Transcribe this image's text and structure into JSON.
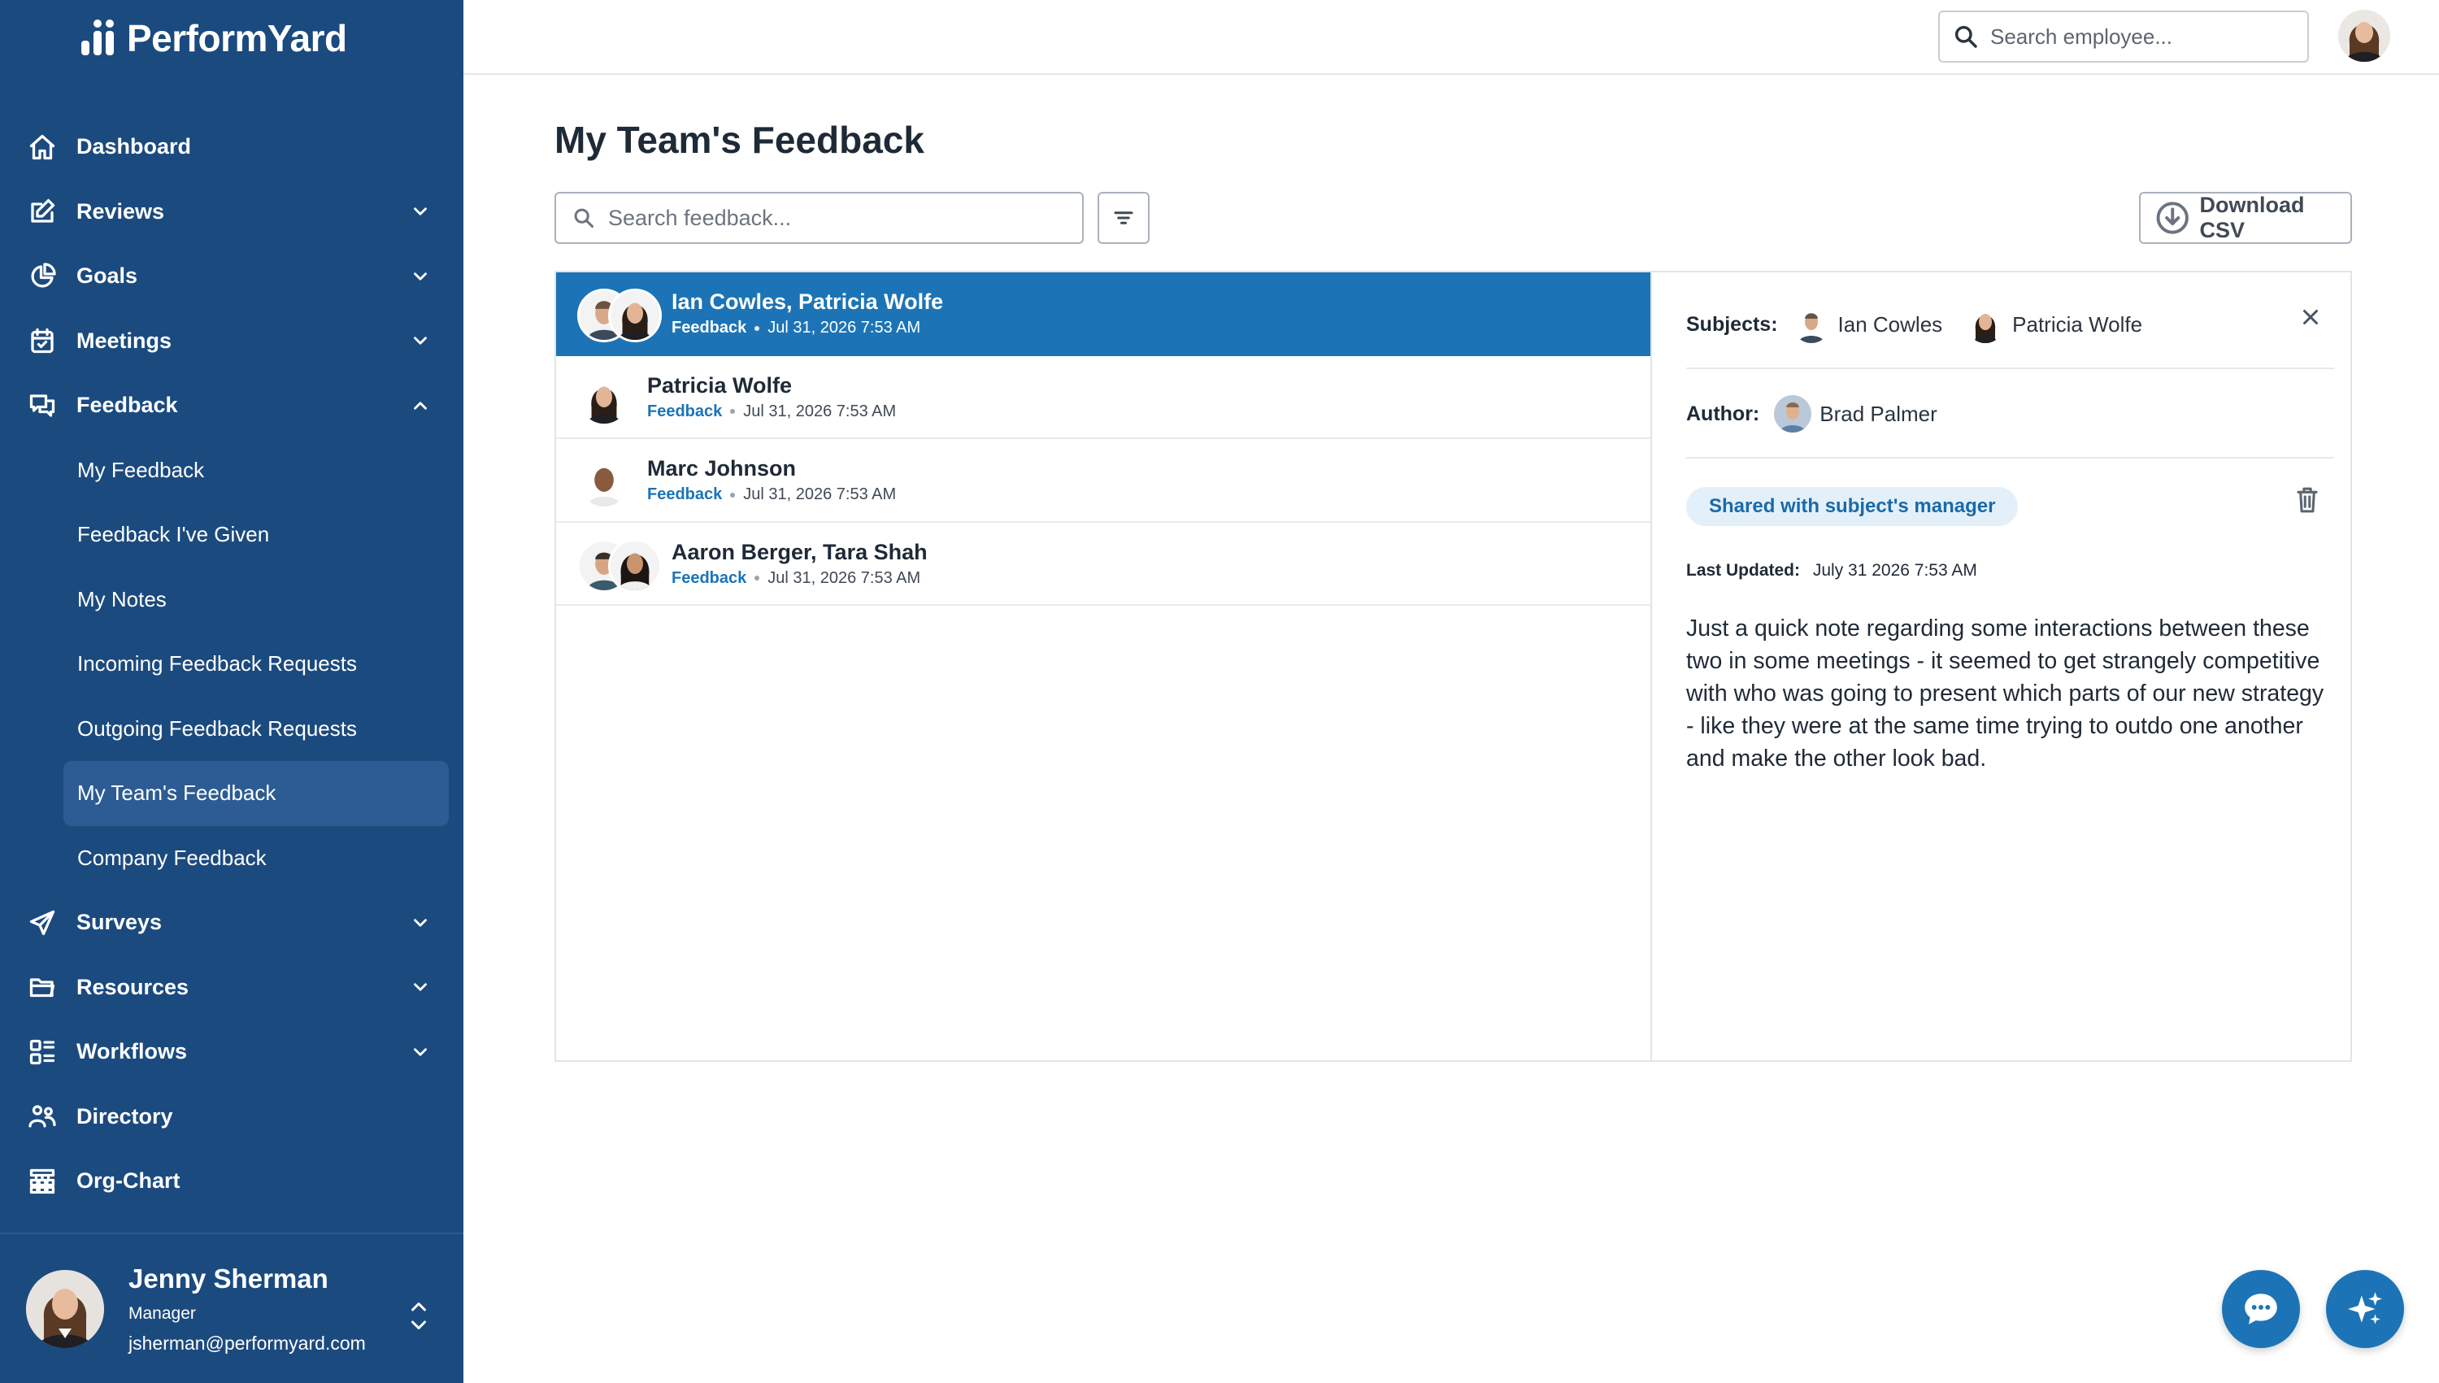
{
  "app": {
    "logo_text": "PerformYard"
  },
  "colors": {
    "sidebar": "#1b4a7e",
    "accent": "#1c74b6",
    "active_nav": "#2c5c93",
    "badge_bg": "#e3f0fa"
  },
  "sidebar": {
    "items": [
      {
        "label": "Dashboard",
        "icon": "home-icon"
      },
      {
        "label": "Reviews",
        "icon": "edit-icon",
        "expanded": false
      },
      {
        "label": "Goals",
        "icon": "pie-chart-icon",
        "expanded": false
      },
      {
        "label": "Meetings",
        "icon": "calendar-icon",
        "expanded": false
      },
      {
        "label": "Feedback",
        "icon": "chat-bubbles-icon",
        "expanded": true
      },
      {
        "label": "Surveys",
        "icon": "paper-plane-icon",
        "expanded": false
      },
      {
        "label": "Resources",
        "icon": "folder-icon",
        "expanded": false
      },
      {
        "label": "Workflows",
        "icon": "workflow-grid-icon",
        "expanded": false
      },
      {
        "label": "Directory",
        "icon": "people-icon"
      },
      {
        "label": "Org-Chart",
        "icon": "org-chart-icon"
      }
    ],
    "feedback_sub": [
      {
        "label": "My Feedback"
      },
      {
        "label": "Feedback I've Given"
      },
      {
        "label": "My Notes"
      },
      {
        "label": "Incoming Feedback Requests"
      },
      {
        "label": "Outgoing Feedback Requests"
      },
      {
        "label": "My Team's Feedback",
        "active": true
      },
      {
        "label": "Company Feedback"
      }
    ],
    "user": {
      "name": "Jenny Sherman",
      "role": "Manager",
      "email": "jsherman@performyard.com"
    }
  },
  "topbar": {
    "employee_search_placeholder": "Search employee..."
  },
  "main": {
    "title": "My Team's Feedback",
    "search_placeholder": "Search feedback...",
    "download_label": "Download CSV"
  },
  "feedback_list": [
    {
      "names": "Ian Cowles, Patricia Wolfe",
      "type": "Feedback",
      "date": "Jul 31, 2026 7:53 AM",
      "selected": true
    },
    {
      "names": "Patricia Wolfe",
      "type": "Feedback",
      "date": "Jul 31, 2026 7:53 AM"
    },
    {
      "names": "Marc Johnson",
      "type": "Feedback",
      "date": "Jul 31, 2026 7:53 AM"
    },
    {
      "names": "Aaron Berger, Tara Shah",
      "type": "Feedback",
      "date": "Jul 31, 2026 7:53 AM"
    }
  ],
  "detail": {
    "subjects_label": "Subjects:",
    "subjects": [
      "Ian Cowles",
      "Patricia Wolfe"
    ],
    "author_label": "Author:",
    "author": "Brad Palmer",
    "visibility_badge": "Shared with subject's manager",
    "last_updated_label": "Last Updated:",
    "last_updated": "July 31 2026 7:53 AM",
    "body": "Just a quick note regarding some interactions between these two in some meetings - it seemed to get strangely competitive with who was going to present which parts of our new strategy - like they were at the same time trying to outdo one another and make the other look bad."
  }
}
